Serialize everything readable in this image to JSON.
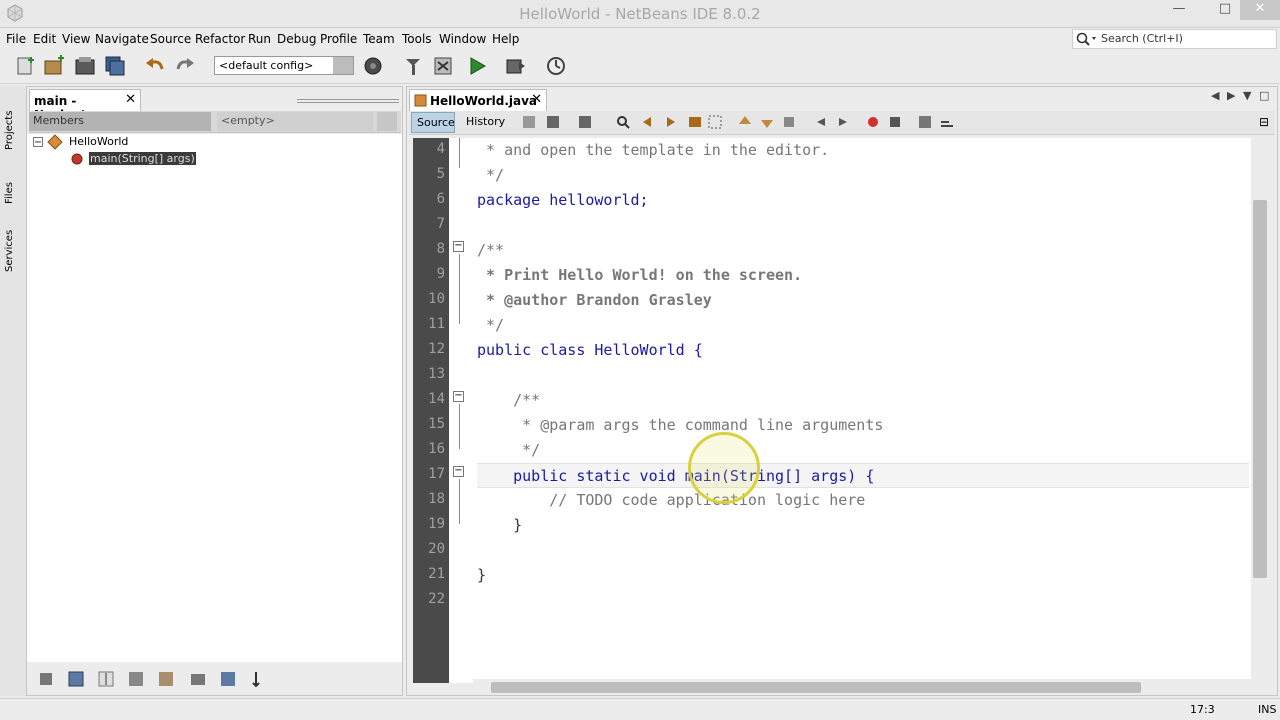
{
  "window": {
    "title": "HelloWorld - NetBeans IDE 8.0.2",
    "minimize_glyph": "—",
    "maximize_glyph": "□",
    "close_glyph": "✕"
  },
  "menu": [
    "File",
    "Edit",
    "View",
    "Navigate",
    "Source",
    "Refactor",
    "Run",
    "Debug",
    "Profile",
    "Team",
    "Tools",
    "Window",
    "Help"
  ],
  "search": {
    "placeholder": "Search (Ctrl+I)"
  },
  "toolbar": {
    "config": "<default config>",
    "icons": [
      "new-file-icon",
      "new-project-icon",
      "open-project-icon",
      "save-all-icon",
      "undo-icon",
      "redo-icon",
      "build-icon",
      "clean-build-icon",
      "run-icon",
      "debug-icon",
      "profile-icon"
    ]
  },
  "side_tabs": [
    "Projects",
    "Files",
    "Services"
  ],
  "navigator": {
    "tab_label": "main - Navigator",
    "members_label": "Members",
    "filter_value": "<empty>",
    "tree": [
      {
        "label": "HelloWorld",
        "icon": "class-icon"
      },
      {
        "label": "main(String[] args)",
        "icon": "method-icon",
        "selected": true
      }
    ]
  },
  "editor": {
    "tab_label": "HelloWorld.java",
    "source_label": "Source",
    "history_label": "History",
    "line_numbers": [
      "4",
      "5",
      "6",
      "7",
      "8",
      "9",
      "10",
      "11",
      "12",
      "13",
      "14",
      "15",
      "16",
      "17",
      "18",
      "19",
      "20",
      "21",
      "22"
    ],
    "lines": [
      {
        "n": 4,
        "text": " * and open the template in the editor."
      },
      {
        "n": 5,
        "text": " */"
      },
      {
        "n": 6,
        "text": "package helloworld;"
      },
      {
        "n": 7,
        "text": ""
      },
      {
        "n": 8,
        "text": "/**"
      },
      {
        "n": 9,
        "text": " * Print Hello World! on the screen."
      },
      {
        "n": 10,
        "text": " * @author Brandon Grasley"
      },
      {
        "n": 11,
        "text": " */"
      },
      {
        "n": 12,
        "text": "public class HelloWorld {"
      },
      {
        "n": 13,
        "text": ""
      },
      {
        "n": 14,
        "text": "    /**"
      },
      {
        "n": 15,
        "text": "     * @param args the command line arguments"
      },
      {
        "n": 16,
        "text": "     */"
      },
      {
        "n": 17,
        "text": "    public static void main(String[] args) {"
      },
      {
        "n": 18,
        "text": "        // TODO code application logic here"
      },
      {
        "n": 19,
        "text": "    }"
      },
      {
        "n": 20,
        "text": ""
      },
      {
        "n": 21,
        "text": "}"
      },
      {
        "n": 22,
        "text": ""
      }
    ]
  },
  "status": {
    "position": "17:3",
    "mode": "INS"
  },
  "colors": {
    "keyword": "#1a1aa6",
    "comment": "#777777",
    "gutter": "#4a4a4a"
  }
}
